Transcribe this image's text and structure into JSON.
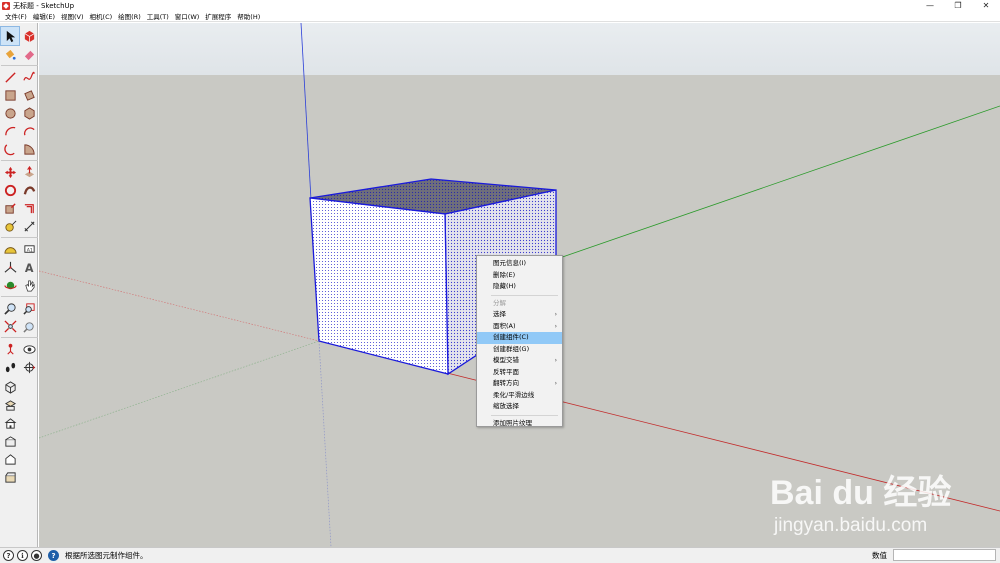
{
  "window": {
    "title": "无标题 - SketchUp",
    "minimize": "—",
    "restore": "❐",
    "close": "✕"
  },
  "menubar": {
    "items": [
      "文件(F)",
      "编辑(E)",
      "视图(V)",
      "相机(C)",
      "绘图(R)",
      "工具(T)",
      "窗口(W)",
      "扩展程序",
      "帮助(H)"
    ]
  },
  "toolbar": {
    "tools": [
      "select-icon",
      "make-component-icon",
      "paint-bucket-icon",
      "eraser-icon",
      "line-icon",
      "freehand-icon",
      "rectangle-icon",
      "rotated-rectangle-icon",
      "circle-icon",
      "polygon-icon",
      "arc-icon",
      "two-point-arc-icon",
      "three-point-arc-icon",
      "pie-icon",
      "move-icon",
      "push-pull-icon",
      "rotate-icon",
      "follow-me-icon",
      "scale-icon",
      "offset-icon",
      "tape-measure-icon",
      "dimension-icon",
      "protractor-icon",
      "text-icon",
      "axes-icon",
      "3d-text-icon",
      "orbit-icon",
      "pan-icon",
      "zoom-icon",
      "zoom-window-icon",
      "zoom-extents-icon",
      "previous-view-icon",
      "position-camera-icon",
      "look-around-icon",
      "walk-icon",
      "section-plane-icon"
    ],
    "views": [
      "iso-view-icon",
      "top-view-icon",
      "front-view-icon",
      "right-view-icon",
      "back-view-icon",
      "left-view-icon"
    ]
  },
  "context_menu": {
    "items": [
      {
        "label": "图元信息(I)",
        "submenu": false,
        "disabled": false,
        "highlight": false
      },
      {
        "label": "删除(E)",
        "submenu": false,
        "disabled": false,
        "highlight": false
      },
      {
        "label": "隐藏(H)",
        "submenu": false,
        "disabled": false,
        "highlight": false
      },
      {
        "sep": true
      },
      {
        "label": "分解",
        "submenu": false,
        "disabled": true,
        "highlight": false
      },
      {
        "label": "选择",
        "submenu": true,
        "disabled": false,
        "highlight": false
      },
      {
        "label": "面积(A)",
        "submenu": true,
        "disabled": false,
        "highlight": false
      },
      {
        "label": "创建组件(C)",
        "submenu": false,
        "disabled": false,
        "highlight": true
      },
      {
        "label": "创建群组(G)",
        "submenu": false,
        "disabled": false,
        "highlight": false
      },
      {
        "label": "模型交错",
        "submenu": true,
        "disabled": false,
        "highlight": false
      },
      {
        "label": "反转平面",
        "submenu": false,
        "disabled": false,
        "highlight": false
      },
      {
        "label": "翻转方向",
        "submenu": true,
        "disabled": false,
        "highlight": false
      },
      {
        "label": "柔化/平滑边线",
        "submenu": false,
        "disabled": false,
        "highlight": false
      },
      {
        "label": "缩放选择",
        "submenu": false,
        "disabled": false,
        "highlight": false
      },
      {
        "sep": true
      },
      {
        "label": "添加照片纹理",
        "submenu": false,
        "disabled": false,
        "highlight": false
      }
    ]
  },
  "statusbar": {
    "icons": [
      "?",
      "ℹ",
      "●"
    ],
    "message": "根据所选图元制作组件。",
    "measurements_label": "数值",
    "measurements_value": ""
  },
  "watermark": {
    "main": "Bai du 经验",
    "url": "jingyan.baidu.com"
  },
  "colors": {
    "background": "#c9c9c4",
    "sky": "#dfe4e8",
    "selection_blue": "#1a1adb",
    "axis_red": "#c22b2b",
    "axis_green": "#2a9a2a",
    "axis_blue": "#2b3fd8",
    "menu_highlight": "#91c9f7"
  }
}
